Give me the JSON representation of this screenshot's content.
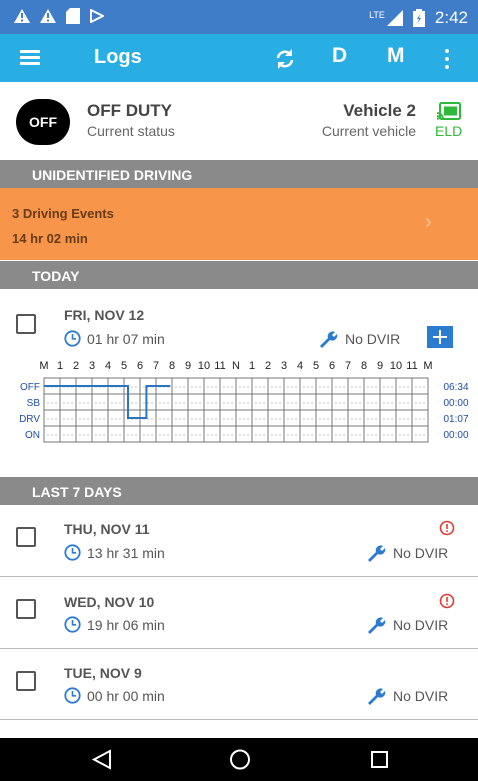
{
  "status_bar": {
    "time": "2:42",
    "network": "LTE",
    "icons": [
      "alert-triangle-icon",
      "alert-triangle-icon",
      "sd-card-icon",
      "play-store-icon",
      "signal-icon",
      "battery-icon"
    ]
  },
  "toolbar": {
    "title": "Logs",
    "d_label": "D",
    "m_label": "M",
    "icons": [
      "menu-icon",
      "sync-icon",
      "more-vert-icon"
    ]
  },
  "status": {
    "badge": "OFF",
    "duty_status": "OFF DUTY",
    "duty_sub": "Current status",
    "vehicle": "Vehicle 2",
    "vehicle_sub": "Current vehicle",
    "eld_label": "ELD"
  },
  "unidentified": {
    "header": "UNIDENTIFIED DRIVING",
    "events": "3 Driving Events",
    "duration": "14 hr  02 min",
    "chevron": "›"
  },
  "today": {
    "header": "TODAY",
    "day": "FRI, NOV 12",
    "hours": "01 hr  07 min",
    "dvir": "No DVIR",
    "graph": {
      "hour_labels": [
        "M",
        "1",
        "2",
        "3",
        "4",
        "5",
        "6",
        "7",
        "8",
        "9",
        "10",
        "11",
        "N",
        "1",
        "2",
        "3",
        "4",
        "5",
        "6",
        "7",
        "8",
        "9",
        "10",
        "11",
        "M"
      ],
      "rows": [
        "OFF",
        "SB",
        "DRV",
        "ON"
      ],
      "totals": [
        "06:34",
        "00:00",
        "01:07",
        "00:00"
      ],
      "segments": [
        {
          "status": "OFF",
          "start_hour": 0,
          "end_hour": 5.25
        },
        {
          "status": "DRV",
          "start_hour": 5.25,
          "end_hour": 6.4
        },
        {
          "status": "OFF",
          "start_hour": 6.4,
          "end_hour": 7.9
        }
      ],
      "line_color": "#2a74c0"
    }
  },
  "last7": {
    "header": "LAST 7 DAYS",
    "days": [
      {
        "day": "THU, NOV 11",
        "hours": "13 hr  31 min",
        "dvir": "No DVIR",
        "alert": true
      },
      {
        "day": "WED, NOV 10",
        "hours": "19 hr  06 min",
        "dvir": "No DVIR",
        "alert": true
      },
      {
        "day": "TUE, NOV 9",
        "hours": "00 hr  00 min",
        "dvir": "No DVIR",
        "alert": false
      }
    ]
  },
  "colors": {
    "status_bar": "#3f7dc8",
    "toolbar": "#29aee3",
    "section_header": "#8a8a8a",
    "unidentified_bar": "#f7954a",
    "eld_green": "#2fb83a",
    "alert_red": "#e53935",
    "accent_blue": "#2b7bd0"
  },
  "nav": {
    "icons": [
      "back-icon",
      "home-icon",
      "recents-icon"
    ]
  }
}
